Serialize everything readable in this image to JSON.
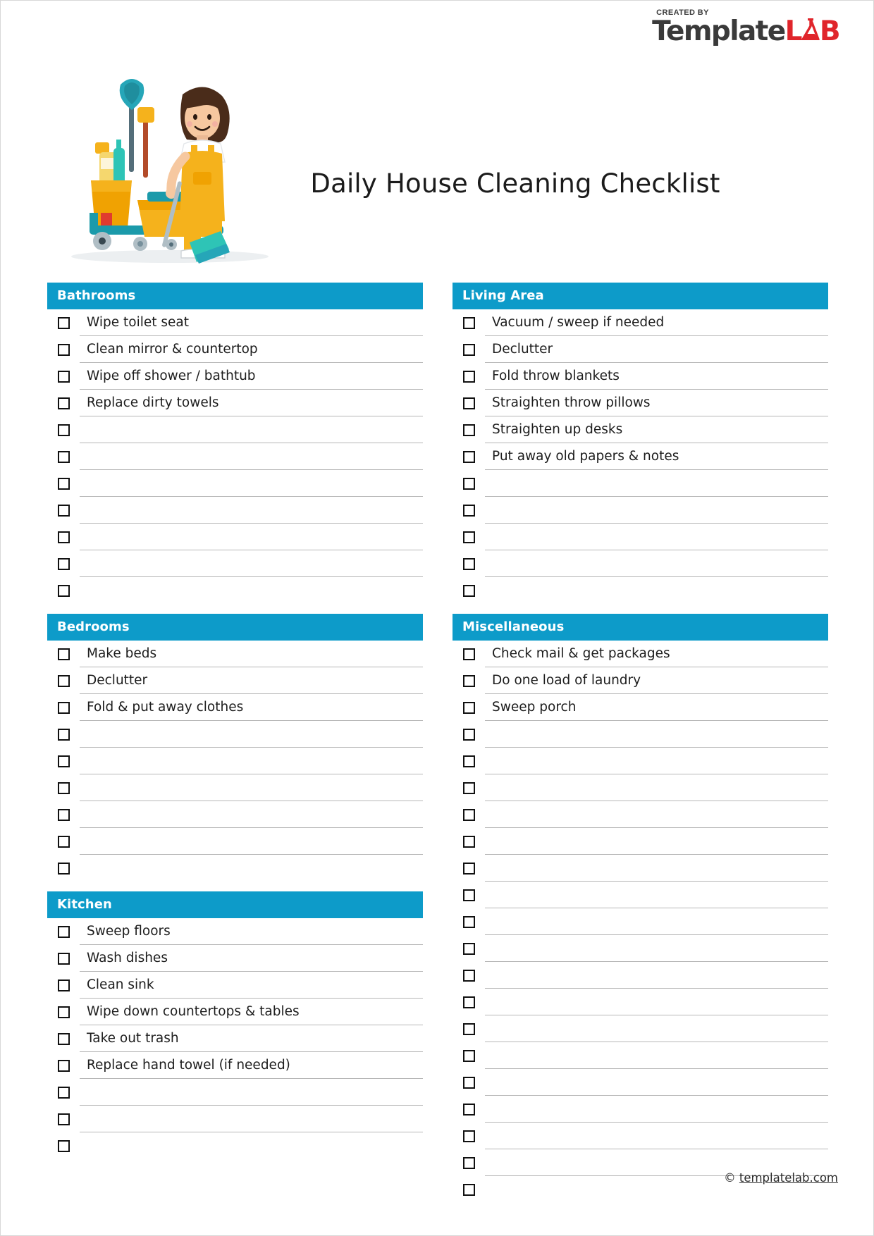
{
  "brand": {
    "created_by": "CREATED BY",
    "name_dark": "Template",
    "name_accent_l": "L",
    "name_accent_b": "B",
    "accent_color": "#e0252b",
    "dark_color": "#3a3a3a"
  },
  "header": {
    "title": "Daily House Cleaning Checklist"
  },
  "theme": {
    "section_header_bg": "#0d9bc9",
    "section_header_text": "#ffffff",
    "row_rule": "#b6b6b6",
    "checkbox_border": "#111111"
  },
  "illustration": {
    "alt": "cleaning-lady-with-mop-and-janitorial-cart"
  },
  "columns": [
    {
      "id": "left",
      "sections": [
        {
          "id": "bathrooms",
          "title": "Bathrooms",
          "items": [
            "Wipe toilet seat",
            "Clean mirror & countertop",
            "Wipe off shower / bathtub",
            "Replace dirty towels",
            "",
            "",
            "",
            "",
            "",
            "",
            ""
          ]
        },
        {
          "id": "bedrooms",
          "title": "Bedrooms",
          "items": [
            "Make beds",
            "Declutter",
            "Fold & put away clothes",
            "",
            "",
            "",
            "",
            "",
            ""
          ]
        },
        {
          "id": "kitchen",
          "title": "Kitchen",
          "items": [
            "Sweep floors",
            "Wash dishes",
            "Clean sink",
            "Wipe down countertops & tables",
            "Take out trash",
            "Replace hand towel (if needed)",
            "",
            "",
            ""
          ]
        }
      ]
    },
    {
      "id": "right",
      "sections": [
        {
          "id": "living-area",
          "title": "Living Area",
          "items": [
            "Vacuum / sweep if needed",
            "Declutter",
            "Fold throw blankets",
            "Straighten throw pillows",
            "Straighten up desks",
            "Put away old papers & notes",
            "",
            "",
            "",
            "",
            ""
          ]
        },
        {
          "id": "miscellaneous",
          "title": "Miscellaneous",
          "items": [
            "Check mail & get packages",
            "Do one load of laundry",
            "Sweep porch",
            "",
            "",
            "",
            "",
            "",
            "",
            "",
            "",
            "",
            "",
            "",
            "",
            "",
            "",
            "",
            "",
            "",
            ""
          ]
        }
      ]
    }
  ],
  "footer": {
    "copyright_symbol": "©",
    "site": "templatelab.com"
  }
}
